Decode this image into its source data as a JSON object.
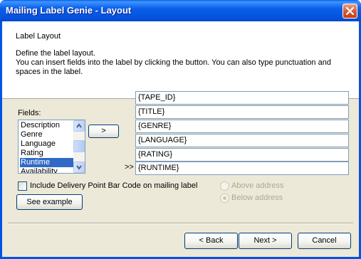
{
  "window": {
    "title": "Mailing Label Genie - Layout"
  },
  "header": {
    "title": "Label Layout",
    "desc_line1": "Define the label layout.",
    "desc_line2": "You can insert fields into the label by clicking the button.  You can also type punctuation and",
    "desc_line3": "spaces in the label."
  },
  "fields": {
    "label": "Fields:",
    "items": [
      "Description",
      "Genre",
      "Language",
      "Rating",
      "Runtime",
      "Availability"
    ],
    "selected": "Runtime",
    "insert_button": ">"
  },
  "label_lines": {
    "current_marker": ">>",
    "lines": [
      "{TAPE_ID}",
      "{TITLE}",
      "{GENRE}",
      "{LANGUAGE}",
      "{RATING}",
      "{RUNTIME}"
    ]
  },
  "barcode": {
    "checkbox_label": "Include Delivery Point Bar Code on mailing label",
    "checked": false,
    "above_label": "Above address",
    "below_label": "Below address",
    "selected": "below",
    "see_example": "See example"
  },
  "footer": {
    "back": "< Back",
    "next": "Next >",
    "cancel": "Cancel"
  },
  "colors": {
    "titlebar": "#0054e3",
    "selection": "#316ac5",
    "dialog_bg": "#ece9d8"
  }
}
